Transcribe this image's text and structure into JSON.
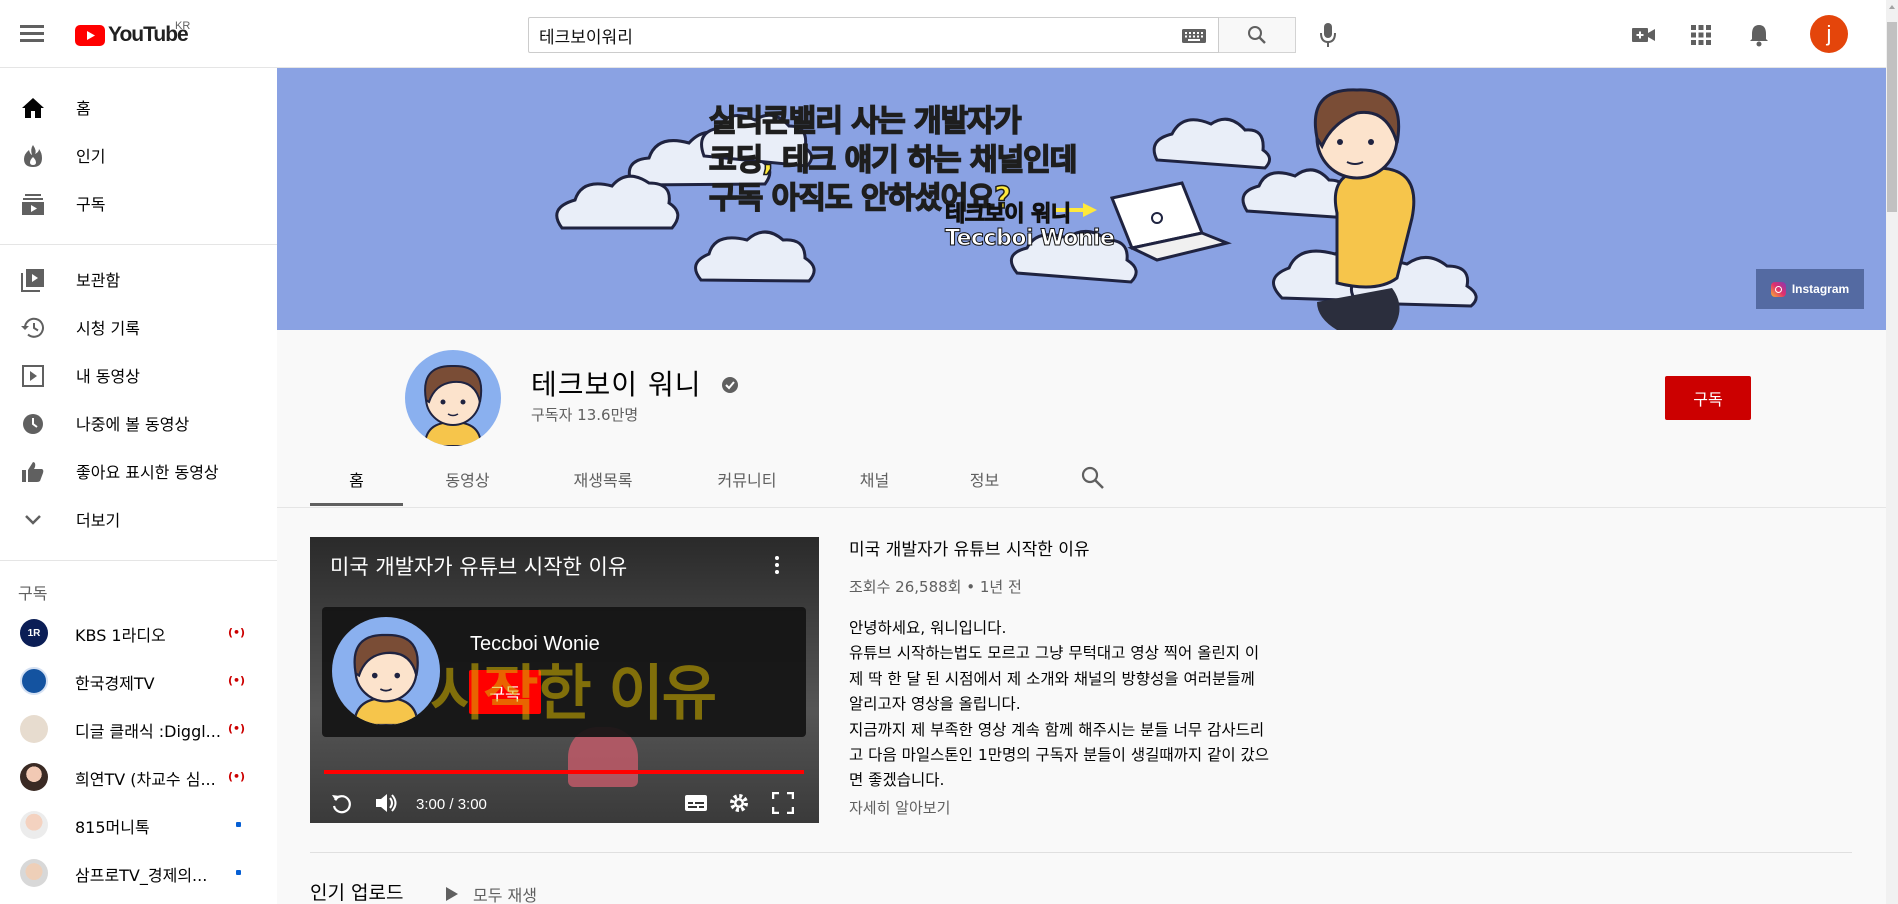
{
  "header": {
    "logo_text": "YouTube",
    "logo_region": "KR",
    "search_value": "테크보이워리"
  },
  "sidebar": {
    "main": [
      {
        "label": "홈",
        "icon": "home-icon"
      },
      {
        "label": "인기",
        "icon": "trending-icon"
      },
      {
        "label": "구독",
        "icon": "subscriptions-icon"
      }
    ],
    "library": [
      {
        "label": "보관함",
        "icon": "library-icon"
      },
      {
        "label": "시청 기록",
        "icon": "history-icon"
      },
      {
        "label": "내 동영상",
        "icon": "your-videos-icon"
      },
      {
        "label": "나중에 볼 동영상",
        "icon": "watch-later-icon"
      },
      {
        "label": "좋아요 표시한 동영상",
        "icon": "liked-icon"
      },
      {
        "label": "더보기",
        "icon": "chevron-down-icon"
      }
    ],
    "subs_title": "구독",
    "subs": [
      {
        "label": "KBS 1라디오",
        "status": "live"
      },
      {
        "label": "한국경제TV",
        "status": "live"
      },
      {
        "label": "디글 클래식 :Diggl...",
        "status": "live"
      },
      {
        "label": "희연TV (차교수 심...",
        "status": "live"
      },
      {
        "label": "815머니톡",
        "status": "new"
      },
      {
        "label": "삼프로TV_경제의...",
        "status": "new"
      }
    ]
  },
  "banner": {
    "line1": "실리콘밸리 사는 개발자가",
    "line2": "코딩, 테크 얘기 하는 채널인데",
    "line3": "구독 아직도 안하셨어요?",
    "sig1": "테크보이 워니",
    "sig2": "Teccboi Wonie",
    "insta_label": "Instagram"
  },
  "channel": {
    "name": "테크보이 워니",
    "subs": "구독자 13.6만명",
    "subscribe": "구독"
  },
  "tabs": [
    "홈",
    "동영상",
    "재생목록",
    "커뮤니티",
    "채널",
    "정보"
  ],
  "video": {
    "overlay_title": "미국 개발자가 유튜브 시작한 이유",
    "bg_text": "시작한 이유",
    "card_name": "Teccboi Wonie",
    "card_sub": "구독",
    "time": "3:00 / 3:00",
    "progress": 1.0
  },
  "details": {
    "title": "미국 개발자가 유튜브 시작한 이유",
    "meta": "조회수 26,588회 • 1년 전",
    "desc": [
      "안녕하세요, 워니입니다.",
      "유튜브 시작하는법도 모르고 그냥 무턱대고 영상 찍어 올린지 이",
      "제 딱 한 달 된 시점에서 제 소개와 채널의 방향성을 여러분들께",
      "알리고자 영상을 올립니다.",
      "지금까지 제 부족한 영상 계속 함께 해주시는 분들 너무 감사드리",
      "고 다음 마일스톤인 1만명의 구독자 분들이 생길때까지 같이 갔으",
      "면 좋겠습니다."
    ],
    "more": "자세히 알아보기"
  },
  "section": {
    "title": "인기 업로드",
    "play_all": "모두 재생"
  },
  "colors": {
    "red": "#cc0000",
    "banner": "#8aa2e3",
    "yt_red": "#ff0000"
  }
}
